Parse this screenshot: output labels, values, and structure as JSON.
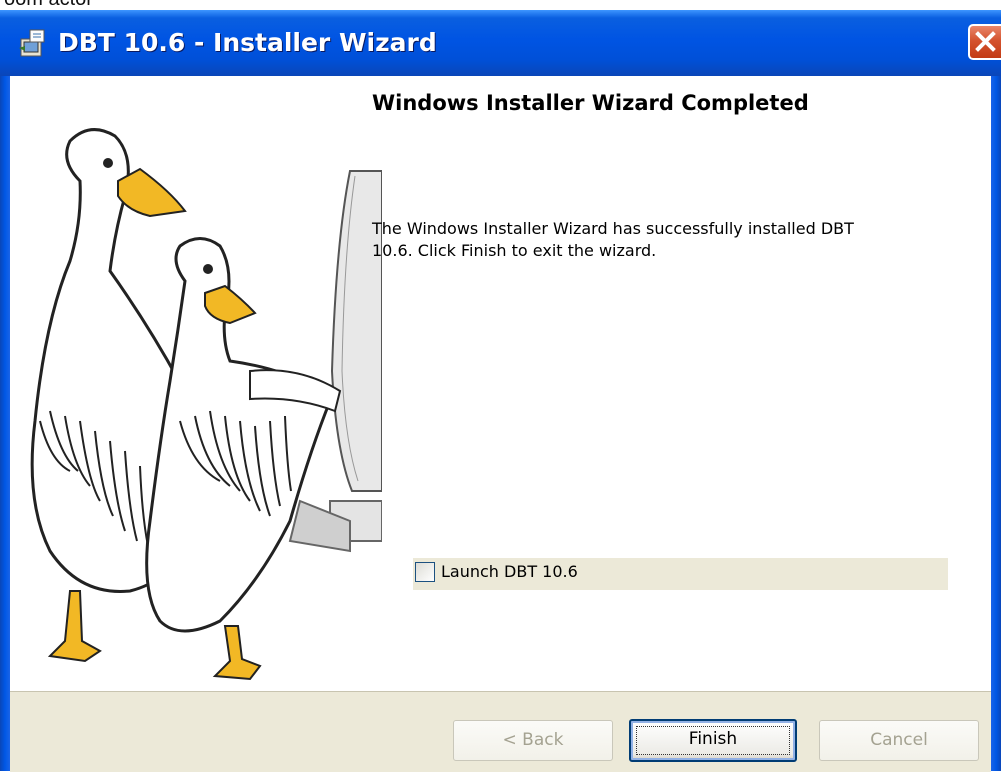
{
  "top_fragment": "oom actor",
  "window": {
    "title": "DBT 10.6 - Installer Wizard"
  },
  "page": {
    "heading": "Windows Installer Wizard Completed",
    "message_line1": "The Windows Installer Wizard has successfully installed DBT",
    "message_line2": "10.6. Click Finish to exit the wizard.",
    "launch_checkbox": {
      "label": "Launch DBT 10.6",
      "checked": false
    }
  },
  "buttons": {
    "back": "< Back",
    "finish": "Finish",
    "cancel": "Cancel",
    "back_enabled": false,
    "cancel_enabled": false
  },
  "colors": {
    "titlebar": "#0054e3",
    "close_button": "#d4532f",
    "dialog_face": "#ece9d8"
  }
}
